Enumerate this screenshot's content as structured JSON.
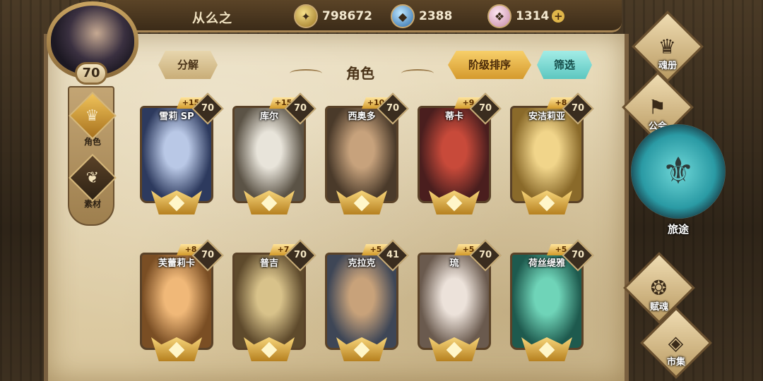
{
  "header": {
    "player_name": "从么之",
    "player_level": "70",
    "currencies": [
      {
        "icon": "coin-icon",
        "value": "798672"
      },
      {
        "icon": "blue-crystal-icon",
        "value": "2388"
      },
      {
        "icon": "pink-gem-icon",
        "value": "1314",
        "plus": "+"
      }
    ]
  },
  "left_tabs": [
    {
      "label": "角色",
      "icon": "character-icon",
      "active": true
    },
    {
      "label": "素材",
      "icon": "material-icon",
      "active": false
    }
  ],
  "toolbar": {
    "decompose_label": "分解",
    "title": "角色",
    "sort_label": "阶级排序",
    "filter_label": "筛选"
  },
  "cards": [
    {
      "name": "雪莉 SP",
      "plus": "+15",
      "level": "70",
      "c1": "#2d3a5e",
      "c2": "#b9c8e6"
    },
    {
      "name": "库尔",
      "plus": "+15",
      "level": "70",
      "c1": "#5b5346",
      "c2": "#e8e4da"
    },
    {
      "name": "西奥多",
      "plus": "+10",
      "level": "70",
      "c1": "#4a3a2a",
      "c2": "#c7a27c"
    },
    {
      "name": "蒂卡",
      "plus": "+9",
      "level": "70",
      "c1": "#4a1e1e",
      "c2": "#c84a3a"
    },
    {
      "name": "安洁莉亚",
      "plus": "+8",
      "level": "70",
      "c1": "#8a6a2a",
      "c2": "#f1d58a"
    },
    {
      "name": "芙蕾莉卡",
      "plus": "+8",
      "level": "70",
      "c1": "#7a4e24",
      "c2": "#f0b878"
    },
    {
      "name": "普吉",
      "plus": "+7",
      "level": "70",
      "c1": "#5e4a2c",
      "c2": "#d8c28a"
    },
    {
      "name": "克拉克",
      "plus": "+5",
      "level": "41",
      "c1": "#3e4656",
      "c2": "#c8a27a"
    },
    {
      "name": "琉",
      "plus": "+5",
      "level": "70",
      "c1": "#6a5a4e",
      "c2": "#ece2da"
    },
    {
      "name": "荷丝缇雅",
      "plus": "+5",
      "level": "70",
      "c1": "#1e5a4e",
      "c2": "#6fd4b8"
    }
  ],
  "right_nav": [
    {
      "label": "魂册",
      "icon": "soul-book-icon"
    },
    {
      "label": "公会",
      "icon": "guild-icon"
    },
    {
      "label": "旅途",
      "icon": "journey-icon"
    },
    {
      "label": "赋魂",
      "icon": "soul-infuse-icon"
    },
    {
      "label": "市集",
      "icon": "market-icon"
    }
  ]
}
